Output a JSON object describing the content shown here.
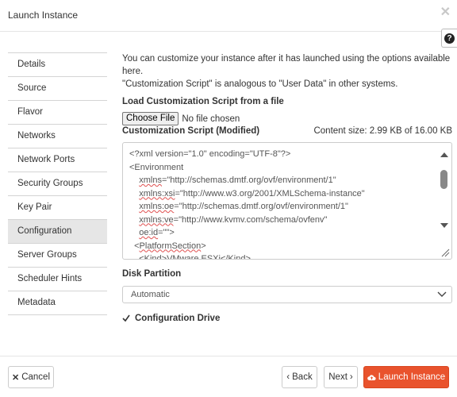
{
  "dialog": {
    "title": "Launch Instance",
    "close_glyph": "✕",
    "help_glyph": "?"
  },
  "nav": [
    {
      "label": "Details",
      "name": "nav-details"
    },
    {
      "label": "Source",
      "name": "nav-source"
    },
    {
      "label": "Flavor",
      "name": "nav-flavor"
    },
    {
      "label": "Networks",
      "name": "nav-networks"
    },
    {
      "label": "Network Ports",
      "name": "nav-network-ports"
    },
    {
      "label": "Security Groups",
      "name": "nav-security-groups"
    },
    {
      "label": "Key Pair",
      "name": "nav-key-pair"
    },
    {
      "label": "Configuration",
      "name": "nav-configuration",
      "active": true
    },
    {
      "label": "Server Groups",
      "name": "nav-server-groups"
    },
    {
      "label": "Scheduler Hints",
      "name": "nav-scheduler-hints"
    },
    {
      "label": "Metadata",
      "name": "nav-metadata"
    }
  ],
  "config": {
    "intro_line1": "You can customize your instance after it has launched using the options available here.",
    "intro_line2": "\"Customization Script\" is analogous to \"User Data\" in other systems.",
    "load_label": "Load Customization Script from a file",
    "choose_file_label": "Choose File",
    "no_file_text": "No file chosen",
    "script_label": "Customization Script (Modified)",
    "content_size": "Content size: 2.99 KB of 16.00 KB",
    "script_lines": [
      "<?xml version=\"1.0\" encoding=\"UTF-8\"?>",
      "<Environment",
      "    xmlns=\"http://schemas.dmtf.org/ovf/environment/1\"",
      "    xmlns:xsi=\"http://www.w3.org/2001/XMLSchema-instance\"",
      "    xmlns:oe=\"http://schemas.dmtf.org/ovf/environment/1\"",
      "    xmlns:ve=\"http://www.kvmv.com/schema/ovfenv\"",
      "    oe:id=\"\">",
      "  <PlatformSection>",
      "    <Kind>VMware ESXi</Kind>"
    ],
    "disk_partition_label": "Disk Partition",
    "disk_partition_value": "Automatic",
    "config_drive_label": "Configuration Drive",
    "config_drive_checked": true
  },
  "footer": {
    "cancel_label": "Cancel",
    "back_label": "Back",
    "next_label": "Next",
    "launch_label": "Launch Instance"
  }
}
